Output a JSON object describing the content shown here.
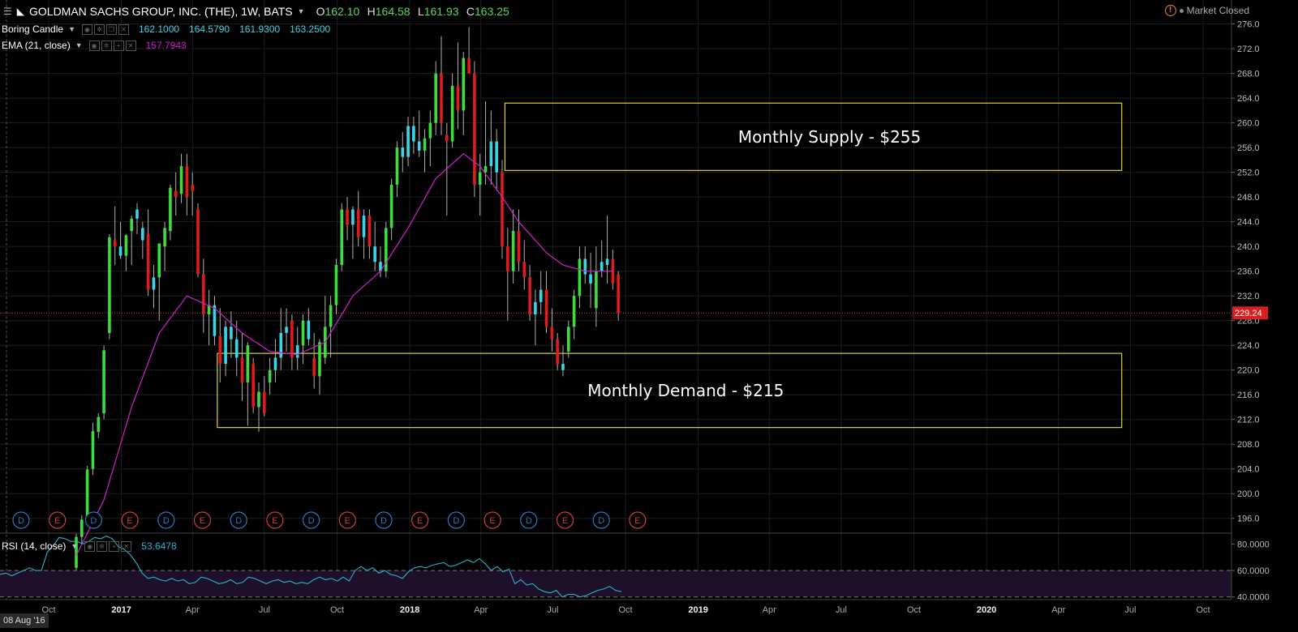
{
  "header": {
    "title": "GOLDMAN SACHS GROUP, INC. (THE), 1W, BATS",
    "ohlc": [
      {
        "k": "O",
        "v": "162.10"
      },
      {
        "k": "H",
        "v": "164.58"
      },
      {
        "k": "L",
        "v": "161.93"
      },
      {
        "k": "C",
        "v": "163.25"
      }
    ],
    "market_status": "Market Closed"
  },
  "indicators": {
    "boring": {
      "label": "Boring Candle",
      "values": [
        "162.1000",
        "164.5790",
        "161.9300",
        "163.2500"
      ]
    },
    "ema": {
      "label": "EMA (21, close)",
      "value": "157.7943"
    },
    "rsi": {
      "label": "RSI (14, close)",
      "value": "53.6478"
    }
  },
  "date_cursor": "08 Aug '16",
  "colors": {
    "up": "#3ddc3d",
    "down": "#e01b1b",
    "boring": "#3ad6e8",
    "ema": "#d21fcf",
    "zone": "#d6d23a",
    "price_line": "#d63c3c",
    "rsi_line": "#28b5c8",
    "rsi_band": "#1e0f2a",
    "d_event": "#2a79c8",
    "e_event": "#d23d3d"
  },
  "chart_data": {
    "type": "candlestick",
    "timeframe": "1W",
    "ylim": [
      194,
      277
    ],
    "yticks": [
      196,
      200,
      204,
      208,
      212,
      216,
      220,
      224,
      228,
      232,
      236,
      240,
      244,
      248,
      252,
      256,
      260,
      264,
      268,
      272,
      276
    ],
    "xticks": [
      {
        "label": "Oct",
        "date": "2016-10-01"
      },
      {
        "label": "2017",
        "date": "2017-01-01"
      },
      {
        "label": "Apr",
        "date": "2017-04-01"
      },
      {
        "label": "Jul",
        "date": "2017-07-01"
      },
      {
        "label": "Oct",
        "date": "2017-10-01"
      },
      {
        "label": "2018",
        "date": "2018-01-01"
      },
      {
        "label": "Apr",
        "date": "2018-04-01"
      },
      {
        "label": "Jul",
        "date": "2018-07-01"
      },
      {
        "label": "Oct",
        "date": "2018-10-01"
      },
      {
        "label": "2019",
        "date": "2019-01-01"
      },
      {
        "label": "Apr",
        "date": "2019-04-01"
      },
      {
        "label": "Jul",
        "date": "2019-07-01"
      },
      {
        "label": "Oct",
        "date": "2019-10-01"
      },
      {
        "label": "2020",
        "date": "2020-01-01"
      },
      {
        "label": "Apr",
        "date": "2020-04-01"
      },
      {
        "label": "Jul",
        "date": "2020-07-01"
      },
      {
        "label": "Oct",
        "date": "2020-10-01"
      }
    ],
    "x_first_tick_date": "2016-10-01",
    "candles": [
      {
        "o": 188.0,
        "h": 193.5,
        "l": 186.0,
        "c": 193.0
      },
      {
        "o": 193.0,
        "h": 196.5,
        "l": 192.0,
        "c": 195.8
      },
      {
        "o": 196.0,
        "h": 204.5,
        "l": 195.0,
        "c": 203.9
      },
      {
        "o": 204.0,
        "h": 211.5,
        "l": 203.0,
        "c": 210.1
      },
      {
        "o": 210.0,
        "h": 213.0,
        "l": 209.0,
        "c": 212.4
      },
      {
        "o": 213.0,
        "h": 224.0,
        "l": 212.0,
        "c": 223.2
      },
      {
        "o": 226.0,
        "h": 242.0,
        "l": 225.0,
        "c": 241.5
      },
      {
        "o": 241.0,
        "h": 246.5,
        "l": 237.0,
        "c": 240.0
      },
      {
        "o": 240.0,
        "h": 244.0,
        "l": 238.0,
        "c": 238.5
      },
      {
        "o": 238.5,
        "h": 242.0,
        "l": 236.0,
        "c": 241.8
      },
      {
        "o": 242.5,
        "h": 245.0,
        "l": 237.0,
        "c": 244.5
      },
      {
        "o": 244.5,
        "h": 247.0,
        "l": 242.0,
        "c": 246.0
      },
      {
        "o": 243.0,
        "h": 244.0,
        "l": 238.0,
        "c": 241.0
      },
      {
        "o": 242.0,
        "h": 246.0,
        "l": 232.0,
        "c": 233.0
      },
      {
        "o": 233.0,
        "h": 237.0,
        "l": 230.0,
        "c": 235.0
      },
      {
        "o": 235.0,
        "h": 240.0,
        "l": 228.0,
        "c": 240.5
      },
      {
        "o": 240.0,
        "h": 244.0,
        "l": 236.0,
        "c": 243.0
      },
      {
        "o": 242.5,
        "h": 250.0,
        "l": 241.0,
        "c": 249.5
      },
      {
        "o": 249.0,
        "h": 252.0,
        "l": 245.0,
        "c": 248.0
      },
      {
        "o": 248.5,
        "h": 255.0,
        "l": 247.0,
        "c": 253.0
      },
      {
        "o": 253.0,
        "h": 255.0,
        "l": 245.0,
        "c": 248.0
      },
      {
        "o": 250.0,
        "h": 252.0,
        "l": 245.0,
        "c": 249.0
      },
      {
        "o": 246.0,
        "h": 247.0,
        "l": 235.0,
        "c": 235.5
      },
      {
        "o": 235.5,
        "h": 238.0,
        "l": 226.0,
        "c": 229.0
      },
      {
        "o": 229.0,
        "h": 233.0,
        "l": 224.0,
        "c": 230.5
      },
      {
        "o": 230.5,
        "h": 232.0,
        "l": 224.0,
        "c": 225.5
      },
      {
        "o": 225.5,
        "h": 230.0,
        "l": 218.0,
        "c": 221.0
      },
      {
        "o": 221.0,
        "h": 228.0,
        "l": 219.0,
        "c": 227.0
      },
      {
        "o": 227.0,
        "h": 229.5,
        "l": 222.0,
        "c": 225.0
      },
      {
        "o": 225.0,
        "h": 228.0,
        "l": 219.0,
        "c": 222.0
      },
      {
        "o": 222.0,
        "h": 226.0,
        "l": 215.0,
        "c": 218.0
      },
      {
        "o": 218.0,
        "h": 224.5,
        "l": 211.0,
        "c": 224.0
      },
      {
        "o": 221.0,
        "h": 222.0,
        "l": 213.0,
        "c": 214.0
      },
      {
        "o": 214.0,
        "h": 218.0,
        "l": 210.0,
        "c": 216.5
      },
      {
        "o": 216.5,
        "h": 219.0,
        "l": 212.5,
        "c": 213.0
      },
      {
        "o": 218.0,
        "h": 222.0,
        "l": 216.0,
        "c": 220.0
      },
      {
        "o": 220.0,
        "h": 225.0,
        "l": 218.0,
        "c": 222.0
      },
      {
        "o": 222.0,
        "h": 230.0,
        "l": 220.0,
        "c": 226.0
      },
      {
        "o": 226.0,
        "h": 230.0,
        "l": 223.0,
        "c": 227.0
      },
      {
        "o": 228.0,
        "h": 229.0,
        "l": 220.0,
        "c": 222.0
      },
      {
        "o": 222.0,
        "h": 227.0,
        "l": 220.0,
        "c": 224.0
      },
      {
        "o": 224.0,
        "h": 229.0,
        "l": 221.0,
        "c": 228.0
      },
      {
        "o": 228.0,
        "h": 230.0,
        "l": 224.0,
        "c": 225.0
      },
      {
        "o": 222.0,
        "h": 226.0,
        "l": 217.0,
        "c": 219.0
      },
      {
        "o": 219.0,
        "h": 225.0,
        "l": 216.0,
        "c": 224.5
      },
      {
        "o": 222.0,
        "h": 232.0,
        "l": 221.0,
        "c": 227.0
      },
      {
        "o": 227.0,
        "h": 232.0,
        "l": 222.0,
        "c": 230.5
      },
      {
        "o": 230.5,
        "h": 238.0,
        "l": 229.0,
        "c": 237.0
      },
      {
        "o": 237.0,
        "h": 247.0,
        "l": 236.0,
        "c": 246.0
      },
      {
        "o": 246.0,
        "h": 248.0,
        "l": 241.0,
        "c": 243.5
      },
      {
        "o": 243.5,
        "h": 246.5,
        "l": 238.0,
        "c": 246.0
      },
      {
        "o": 246.0,
        "h": 249.0,
        "l": 240.0,
        "c": 241.5
      },
      {
        "o": 241.5,
        "h": 246.0,
        "l": 238.0,
        "c": 245.0
      },
      {
        "o": 245.0,
        "h": 246.0,
        "l": 238.0,
        "c": 240.0
      },
      {
        "o": 240.0,
        "h": 244.0,
        "l": 236.0,
        "c": 237.5
      },
      {
        "o": 237.5,
        "h": 240.0,
        "l": 235.0,
        "c": 236.0
      },
      {
        "o": 236.0,
        "h": 244.0,
        "l": 235.0,
        "c": 243.0
      },
      {
        "o": 243.0,
        "h": 251.0,
        "l": 241.0,
        "c": 250.0
      },
      {
        "o": 250.0,
        "h": 257.0,
        "l": 248.0,
        "c": 256.0
      },
      {
        "o": 256.0,
        "h": 258.5,
        "l": 252.0,
        "c": 254.5
      },
      {
        "o": 254.5,
        "h": 261.0,
        "l": 253.0,
        "c": 259.5
      },
      {
        "o": 259.5,
        "h": 261.0,
        "l": 255.0,
        "c": 257.0
      },
      {
        "o": 257.0,
        "h": 262.0,
        "l": 254.5,
        "c": 255.5
      },
      {
        "o": 255.5,
        "h": 259.0,
        "l": 252.0,
        "c": 257.5
      },
      {
        "o": 257.5,
        "h": 262.0,
        "l": 253.0,
        "c": 260.0
      },
      {
        "o": 260.0,
        "h": 270.0,
        "l": 258.0,
        "c": 268.0
      },
      {
        "o": 268.0,
        "h": 274.0,
        "l": 258.0,
        "c": 260.0
      },
      {
        "o": 258.0,
        "h": 260.0,
        "l": 245.0,
        "c": 257.0
      },
      {
        "o": 257.0,
        "h": 268.0,
        "l": 256.0,
        "c": 266.0
      },
      {
        "o": 266.0,
        "h": 273.0,
        "l": 259.0,
        "c": 262.0
      },
      {
        "o": 262.0,
        "h": 271.5,
        "l": 258.0,
        "c": 270.5
      },
      {
        "o": 270.5,
        "h": 275.5,
        "l": 268.0,
        "c": 268.0
      },
      {
        "o": 268.0,
        "h": 270.0,
        "l": 248.0,
        "c": 250.0
      },
      {
        "o": 250.0,
        "h": 255.0,
        "l": 245.0,
        "c": 252.0
      },
      {
        "o": 252.0,
        "h": 263.5,
        "l": 250.0,
        "c": 253.0
      },
      {
        "o": 253.0,
        "h": 262.0,
        "l": 250.0,
        "c": 257.0
      },
      {
        "o": 257.0,
        "h": 259.0,
        "l": 249.0,
        "c": 252.0
      },
      {
        "o": 252.0,
        "h": 254.0,
        "l": 238.0,
        "c": 240.0
      },
      {
        "o": 240.0,
        "h": 243.0,
        "l": 228.0,
        "c": 236.0
      },
      {
        "o": 236.0,
        "h": 246.0,
        "l": 234.0,
        "c": 242.5
      },
      {
        "o": 242.5,
        "h": 246.0,
        "l": 236.0,
        "c": 237.5
      },
      {
        "o": 237.5,
        "h": 241.0,
        "l": 233.0,
        "c": 235.0
      },
      {
        "o": 235.0,
        "h": 237.0,
        "l": 228.0,
        "c": 229.0
      },
      {
        "o": 229.0,
        "h": 233.0,
        "l": 224.0,
        "c": 231.0
      },
      {
        "o": 231.0,
        "h": 236.0,
        "l": 229.0,
        "c": 233.0
      },
      {
        "o": 233.0,
        "h": 236.0,
        "l": 226.0,
        "c": 227.0
      },
      {
        "o": 227.0,
        "h": 230.0,
        "l": 223.0,
        "c": 225.0
      },
      {
        "o": 225.0,
        "h": 226.0,
        "l": 220.0,
        "c": 221.0
      },
      {
        "o": 221.0,
        "h": 224.0,
        "l": 219.0,
        "c": 220.0
      },
      {
        "o": 223.0,
        "h": 228.0,
        "l": 222.0,
        "c": 227.0
      },
      {
        "o": 227.0,
        "h": 233.0,
        "l": 225.0,
        "c": 232.0
      },
      {
        "o": 232.0,
        "h": 240.0,
        "l": 230.0,
        "c": 238.0
      },
      {
        "o": 238.0,
        "h": 240.0,
        "l": 234.0,
        "c": 235.5
      },
      {
        "o": 235.5,
        "h": 239.0,
        "l": 230.0,
        "c": 234.0
      },
      {
        "o": 230.0,
        "h": 240.0,
        "l": 227.0,
        "c": 236.0
      },
      {
        "o": 236.0,
        "h": 241.0,
        "l": 235.0,
        "c": 237.5
      },
      {
        "o": 237.0,
        "h": 245.0,
        "l": 234.0,
        "c": 238.0
      },
      {
        "o": 238.0,
        "h": 239.5,
        "l": 233.0,
        "c": 234.0
      },
      {
        "o": 235.5,
        "h": 236.0,
        "l": 228.0,
        "c": 229.2
      }
    ],
    "boring_candle_indices": [
      8,
      11,
      12,
      14,
      25,
      27,
      28,
      29,
      36,
      37,
      38,
      40,
      42,
      50,
      52,
      54,
      55,
      59,
      60,
      61,
      62,
      75,
      76,
      83,
      84,
      88,
      92,
      93,
      95,
      96
    ],
    "ema": [
      {
        "i": 0,
        "v": 190.0
      },
      {
        "i": 5,
        "v": 199.0
      },
      {
        "i": 10,
        "v": 214.0
      },
      {
        "i": 15,
        "v": 226.0
      },
      {
        "i": 20,
        "v": 232.0
      },
      {
        "i": 25,
        "v": 230.0
      },
      {
        "i": 30,
        "v": 226.0
      },
      {
        "i": 35,
        "v": 223.0
      },
      {
        "i": 40,
        "v": 222.5
      },
      {
        "i": 45,
        "v": 224.5
      },
      {
        "i": 50,
        "v": 232.0
      },
      {
        "i": 55,
        "v": 236.0
      },
      {
        "i": 60,
        "v": 243.0
      },
      {
        "i": 65,
        "v": 251.0
      },
      {
        "i": 70,
        "v": 255.0
      },
      {
        "i": 73,
        "v": 253.0
      },
      {
        "i": 77,
        "v": 248.0
      },
      {
        "i": 80,
        "v": 244.0
      },
      {
        "i": 85,
        "v": 239.0
      },
      {
        "i": 88,
        "v": 237.0
      },
      {
        "i": 92,
        "v": 236.0
      },
      {
        "i": 97,
        "v": 236.0
      }
    ],
    "last_price": "229.24",
    "zones": [
      {
        "label": "Monthly Supply - $255",
        "top": 263.2,
        "bottom": 252.3,
        "end_date": "2020-06-20"
      },
      {
        "label": "Monthly Demand - $215",
        "top": 222.7,
        "bottom": 210.7,
        "end_date": "2020-06-20"
      }
    ],
    "events": [
      "D",
      "E",
      "D",
      "E",
      "D",
      "E",
      "D",
      "E",
      "D",
      "E",
      "D",
      "E",
      "D",
      "E",
      "D",
      "E",
      "D",
      "E"
    ],
    "rsi": {
      "ylim": [
        38,
        87
      ],
      "yticks": [
        "40.0000",
        "60.0000",
        "80.0000"
      ],
      "band": [
        40,
        60
      ],
      "values": [
        57,
        58,
        56,
        58,
        60,
        62,
        60,
        60,
        74,
        79,
        85,
        84,
        82,
        82,
        80,
        82,
        85,
        84,
        86,
        84,
        78,
        76,
        72,
        66,
        58,
        54,
        55,
        53,
        52,
        54,
        52,
        53,
        50,
        51,
        55,
        54,
        52,
        50,
        51,
        53,
        50,
        51,
        55,
        54,
        52,
        50,
        52,
        53,
        51,
        52,
        50,
        51,
        50,
        53,
        55,
        53,
        54,
        52,
        55,
        52,
        60,
        63,
        60,
        62,
        58,
        60,
        57,
        56,
        54,
        59,
        62,
        63,
        62,
        64,
        65,
        66,
        63,
        64,
        66,
        68,
        66,
        69,
        65,
        60,
        63,
        59,
        61,
        50,
        53,
        49,
        50,
        46,
        44,
        43,
        45,
        40,
        42,
        42,
        40,
        41,
        43,
        45,
        46,
        48,
        45,
        44
      ]
    }
  }
}
